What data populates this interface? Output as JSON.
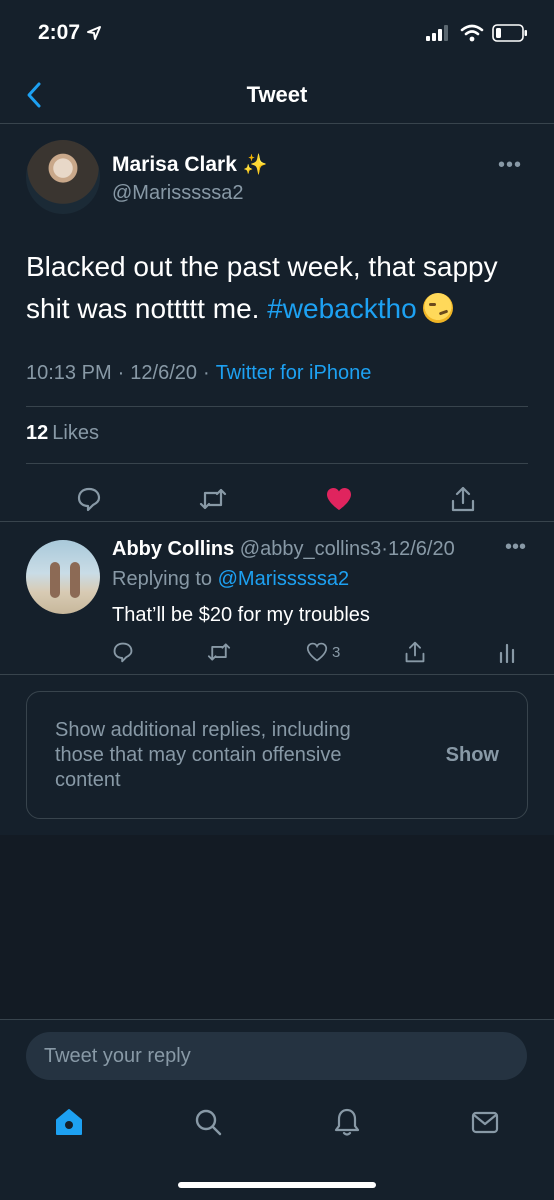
{
  "status_bar": {
    "time": "2:07"
  },
  "nav": {
    "title": "Tweet"
  },
  "tweet": {
    "author_name": "Marisa Clark",
    "author_emoji": "✨",
    "author_handle": "@Marisssssa2",
    "text_before_hashtag": "Blacked out the past week, that sappy shit was nottttt me.",
    "hashtag": "#webacktho",
    "time": "10:13 PM",
    "date": "12/6/20",
    "source": "Twitter for iPhone",
    "likes_count": "12",
    "likes_label": "Likes",
    "liked": true
  },
  "reply": {
    "author_name": "Abby Collins",
    "author_handle": "@abby_collins3",
    "date": "12/6/20",
    "replying_label": "Replying to",
    "replying_to": "@Marisssssa2",
    "text": "That’ll be $20 for my troubles",
    "likes_count": "3"
  },
  "notice": {
    "text": "Show additional replies, including those that may contain offensive content",
    "button": "Show"
  },
  "composer": {
    "placeholder": "Tweet your reply"
  },
  "colors": {
    "accent": "#1da1f2",
    "like": "#e0245e",
    "background": "#15202b",
    "muted": "#8899a6"
  }
}
